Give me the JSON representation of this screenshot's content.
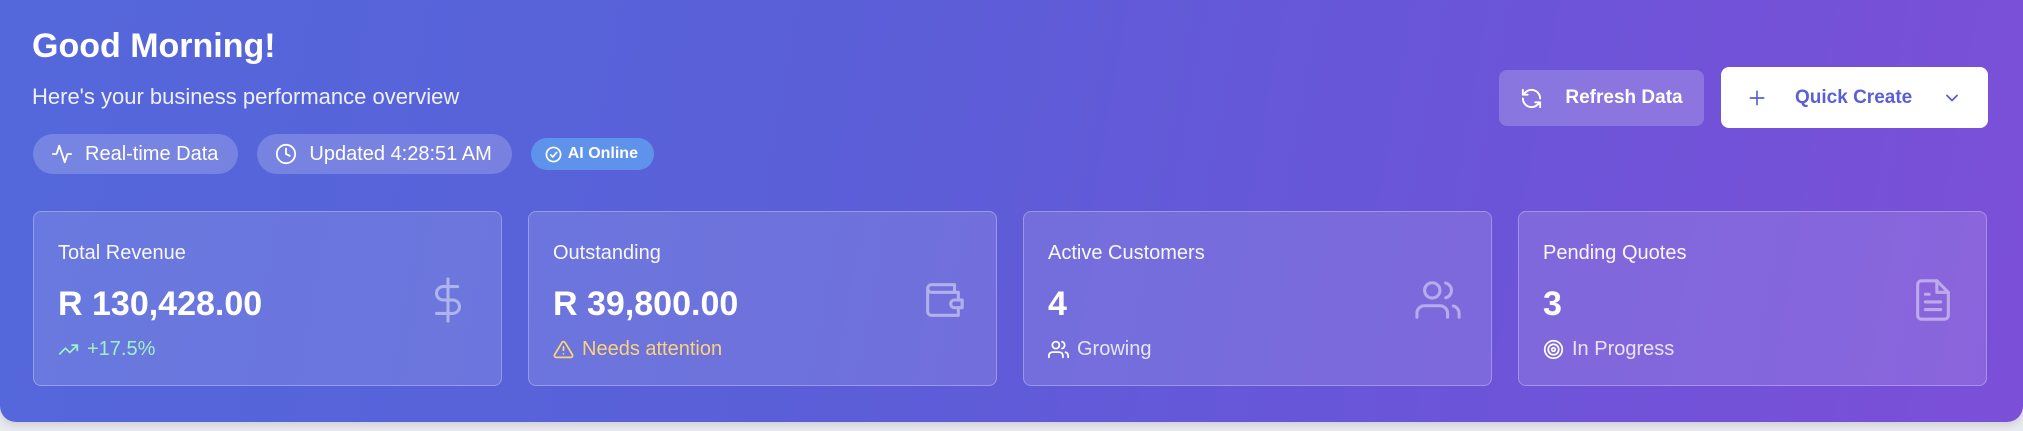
{
  "header": {
    "greeting": "Good Morning!",
    "subtitle": "Here's your business performance overview"
  },
  "badges": [
    {
      "label": "Real-time Data",
      "icon": "activity-icon"
    },
    {
      "label": "Updated 4:28:51 AM",
      "icon": "clock-icon"
    },
    {
      "label": "AI Online",
      "icon": "check-circle-icon"
    }
  ],
  "actions": {
    "refresh_label": "Refresh Data",
    "quick_create_label": "Quick Create"
  },
  "stats": [
    {
      "label": "Total Revenue",
      "value": "R 130,428.00",
      "note": "+17.5%",
      "icon": "dollar-icon",
      "note_icon": "trending-up-icon"
    },
    {
      "label": "Outstanding",
      "value": "R 39,800.00",
      "note": "Needs attention",
      "icon": "wallet-icon",
      "note_icon": "alert-triangle-icon"
    },
    {
      "label": "Active Customers",
      "value": "4",
      "note": "Growing",
      "icon": "users-icon",
      "note_icon": "users-icon"
    },
    {
      "label": "Pending Quotes",
      "value": "3",
      "note": "In Progress",
      "icon": "file-text-icon",
      "note_icon": "target-icon"
    }
  ],
  "colors": {
    "gradient_start": "#5468db",
    "gradient_end": "#7c4fd8",
    "accent": "#5b5fd6",
    "positive": "#9ff2c4",
    "warning": "#fbd37a",
    "ai_badge": "#5f92ea"
  }
}
